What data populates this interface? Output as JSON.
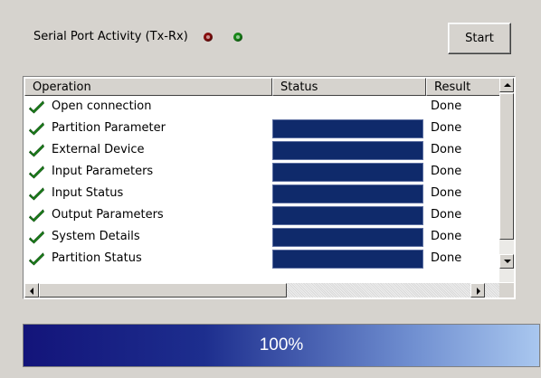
{
  "activity": {
    "label": "Serial Port Activity (Tx-Rx)",
    "tx_led_color": "#8a1010",
    "rx_led_color": "#1a8a1a"
  },
  "start_button": {
    "label": "Start"
  },
  "list": {
    "columns": [
      "Operation",
      "Status",
      "Result"
    ],
    "rows": [
      {
        "icon": "checkmark-icon",
        "operation": "Open connection",
        "status_bar": false,
        "result": "Done"
      },
      {
        "icon": "checkmark-icon",
        "operation": "Partition Parameter",
        "status_bar": true,
        "result": "Done"
      },
      {
        "icon": "checkmark-icon",
        "operation": "External Device",
        "status_bar": true,
        "result": "Done"
      },
      {
        "icon": "checkmark-icon",
        "operation": "Input Parameters",
        "status_bar": true,
        "result": "Done"
      },
      {
        "icon": "checkmark-icon",
        "operation": "Input Status",
        "status_bar": true,
        "result": "Done"
      },
      {
        "icon": "checkmark-icon",
        "operation": "Output Parameters",
        "status_bar": true,
        "result": "Done"
      },
      {
        "icon": "checkmark-icon",
        "operation": "System Details",
        "status_bar": true,
        "result": "Done"
      },
      {
        "icon": "checkmark-icon",
        "operation": "Partition Status",
        "status_bar": true,
        "result": "Done"
      }
    ],
    "status_bar_color": "#0f2a6b"
  },
  "progress": {
    "percent": 100,
    "text": "100%"
  }
}
